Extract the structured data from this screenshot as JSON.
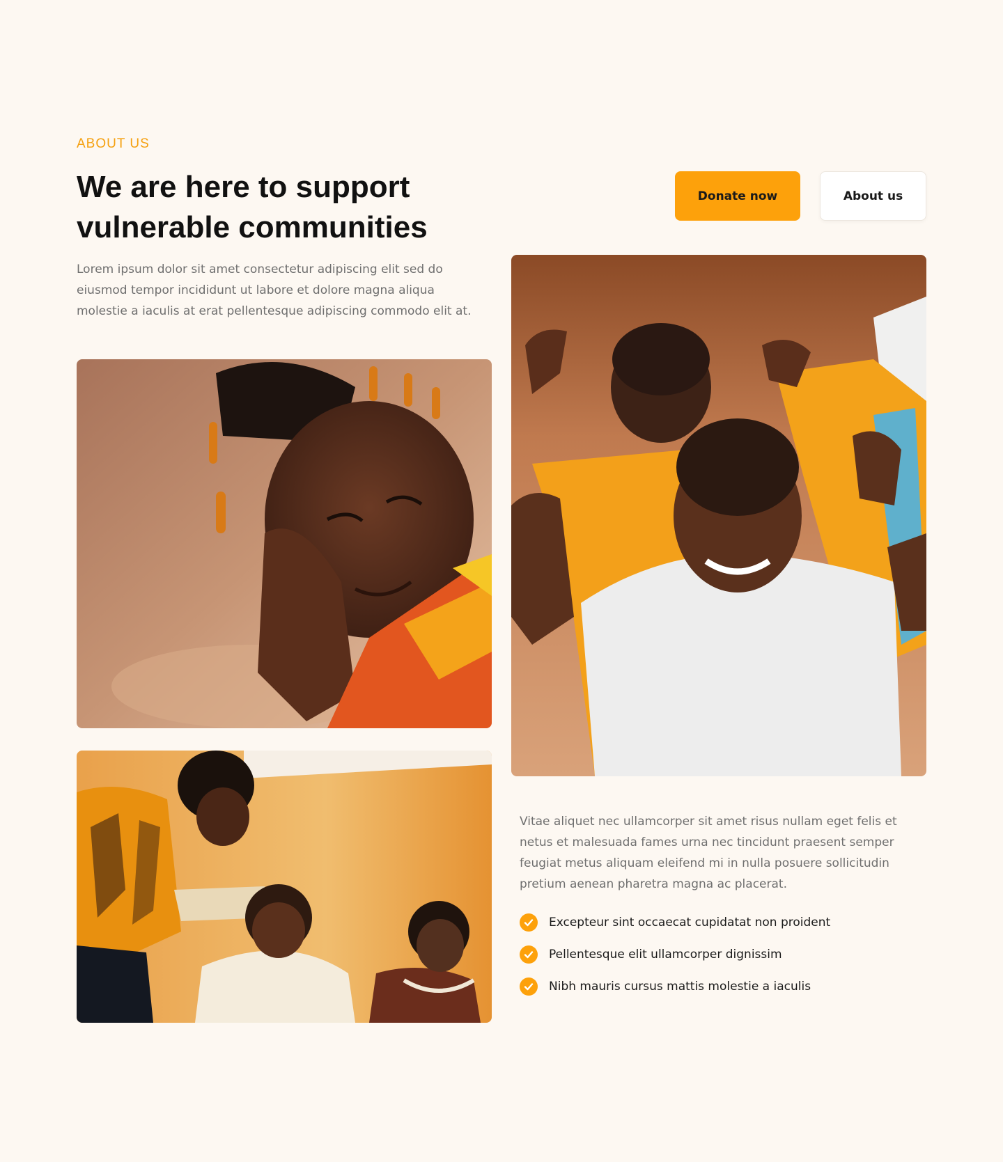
{
  "section": {
    "eyebrow": "ABOUT US",
    "title": "We are here to support vulnerable communities",
    "intro": "Lorem ipsum dolor sit amet consectetur adipiscing elit sed do eiusmod tempor incididunt ut labore et dolore magna aliqua molestie a iaculis at erat pellentesque adipiscing commodo elit at."
  },
  "actions": {
    "donate_label": "Donate now",
    "about_label": "About us"
  },
  "images": {
    "girl": "photo-smiling-girl",
    "classroom": "photo-teacher-classroom",
    "boys": "photo-cheering-boys"
  },
  "details": {
    "body": "Vitae aliquet nec ullamcorper sit amet risus nullam eget felis et netus et malesuada fames urna nec tincidunt praesent semper feugiat metus aliquam eleifend mi in nulla posuere sollicitudin pretium aenean pharetra magna ac placerat.",
    "checklist": [
      "Excepteur sint occaecat cupidatat non proident",
      "Pellentesque elit ullamcorper dignissim",
      "Nibh mauris cursus mattis molestie a iaculis"
    ]
  },
  "colors": {
    "accent": "#fda10b",
    "background": "#fdf8f2",
    "heading": "#111111",
    "body_text": "#6f6f6f"
  }
}
